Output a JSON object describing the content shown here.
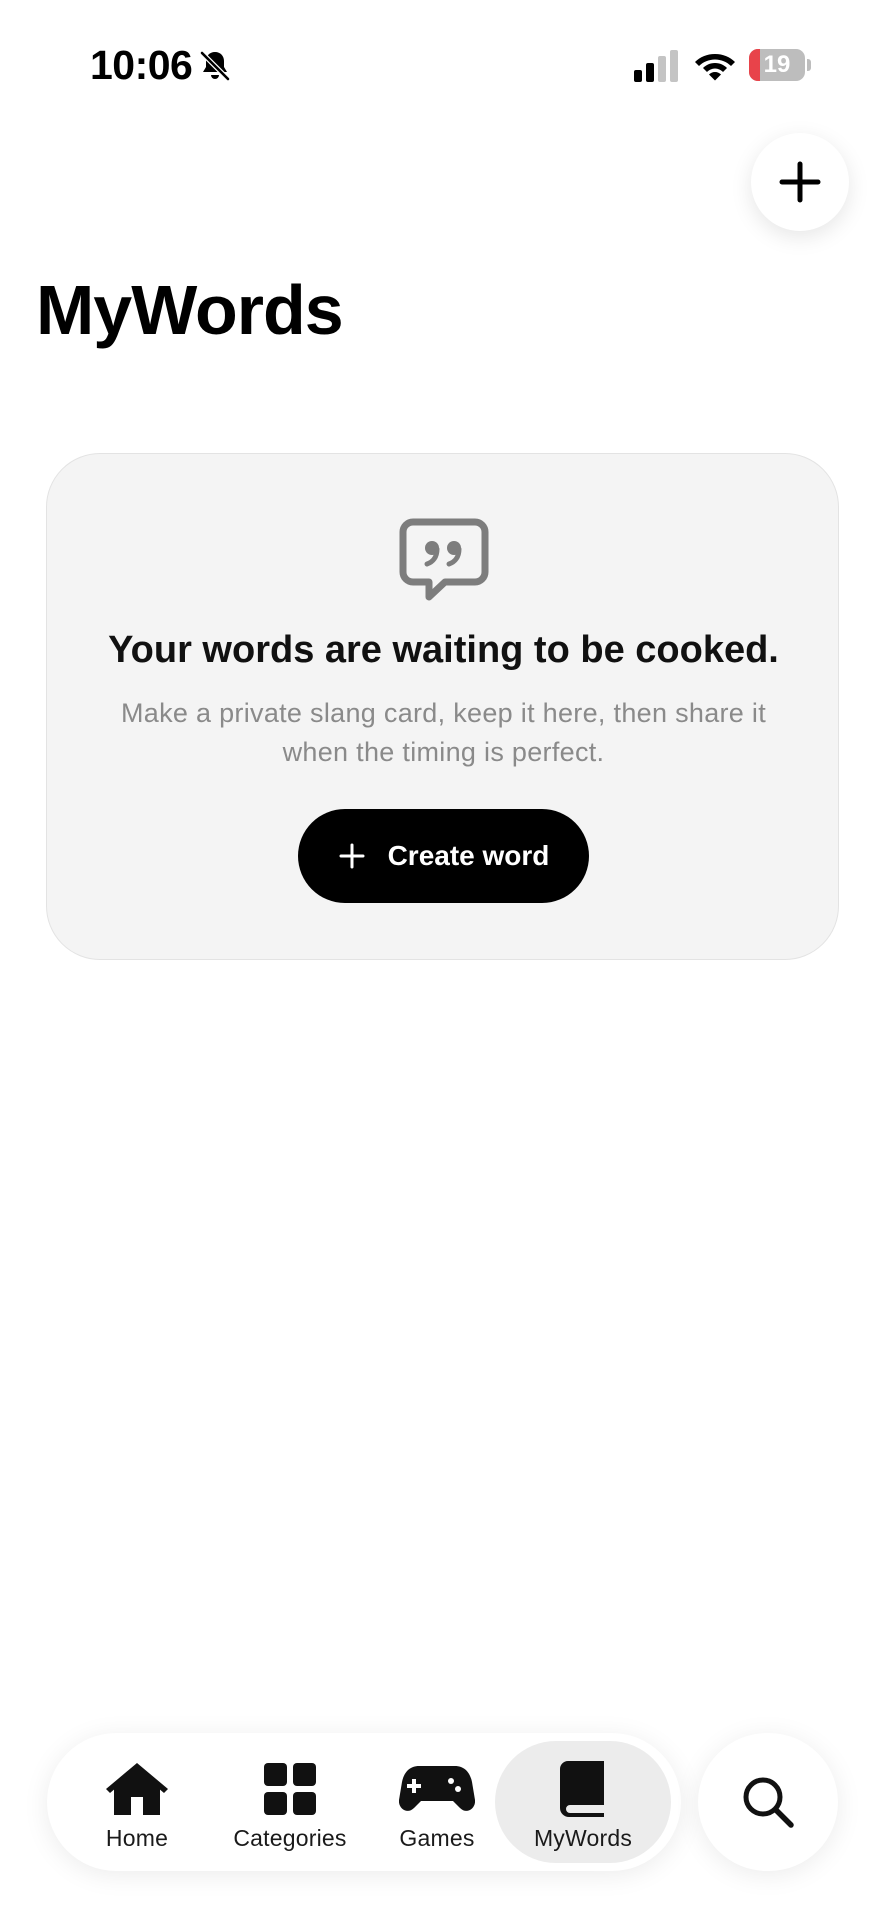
{
  "status_bar": {
    "time": "10:06",
    "battery_level": "19",
    "battery_fraction": 0.19,
    "icons": [
      "bell-slash-icon",
      "signal-icon",
      "wifi-icon",
      "battery-icon"
    ],
    "battery_color": "#e8434a"
  },
  "header": {
    "add_button_icon": "plus-icon",
    "title": "MyWords"
  },
  "empty_state": {
    "icon": "quote-bubble-icon",
    "heading": "Your words are waiting to be cooked.",
    "description": "Make a private slang card, keep it here, then share it when the timing is perfect.",
    "button_label": "Create word",
    "button_icon": "plus-icon"
  },
  "bottom_nav": {
    "items": [
      {
        "label": "Home",
        "icon": "home-icon",
        "active": false
      },
      {
        "label": "Categories",
        "icon": "grid-icon",
        "active": false
      },
      {
        "label": "Games",
        "icon": "gamepad-icon",
        "active": false
      },
      {
        "label": "MyWords",
        "icon": "book-icon",
        "active": true
      }
    ],
    "search_icon": "search-icon"
  },
  "colors": {
    "background": "#ffffff",
    "card_background": "#f4f4f4",
    "primary_button": "#000000",
    "active_tab": "#ececec",
    "muted_text": "#8a8a8a"
  }
}
